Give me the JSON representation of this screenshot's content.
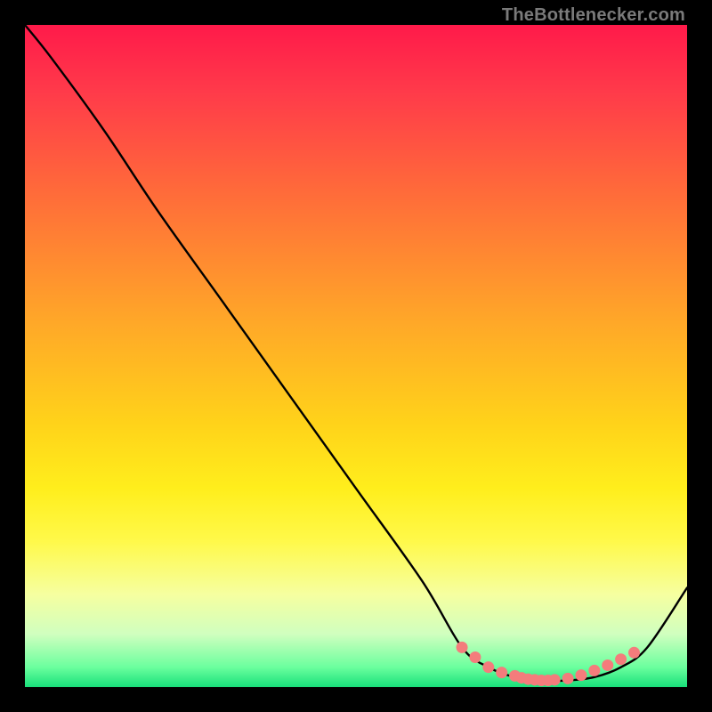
{
  "attribution": "TheBottlenecker.com",
  "chart_data": {
    "type": "line",
    "title": "",
    "xlabel": "",
    "ylabel": "",
    "xlim": [
      0,
      100
    ],
    "ylim": [
      0,
      100
    ],
    "x": [
      0,
      4,
      12,
      20,
      30,
      40,
      50,
      60,
      66,
      70,
      74,
      78,
      82,
      86,
      90,
      94,
      100
    ],
    "values": [
      100,
      95,
      84,
      72,
      58,
      44,
      30,
      16,
      6,
      3,
      1.5,
      1,
      1,
      1.5,
      3,
      6,
      15
    ],
    "marker_points": {
      "x": [
        66,
        68,
        70,
        72,
        74,
        75,
        76,
        77,
        78,
        79,
        80,
        82,
        84,
        86,
        88,
        90,
        92
      ],
      "y": [
        6,
        4.5,
        3,
        2.2,
        1.7,
        1.4,
        1.2,
        1.1,
        1,
        1,
        1.1,
        1.3,
        1.8,
        2.5,
        3.3,
        4.2,
        5.2
      ]
    },
    "marker_color": "#f47c7c",
    "line_color": "#000000"
  }
}
